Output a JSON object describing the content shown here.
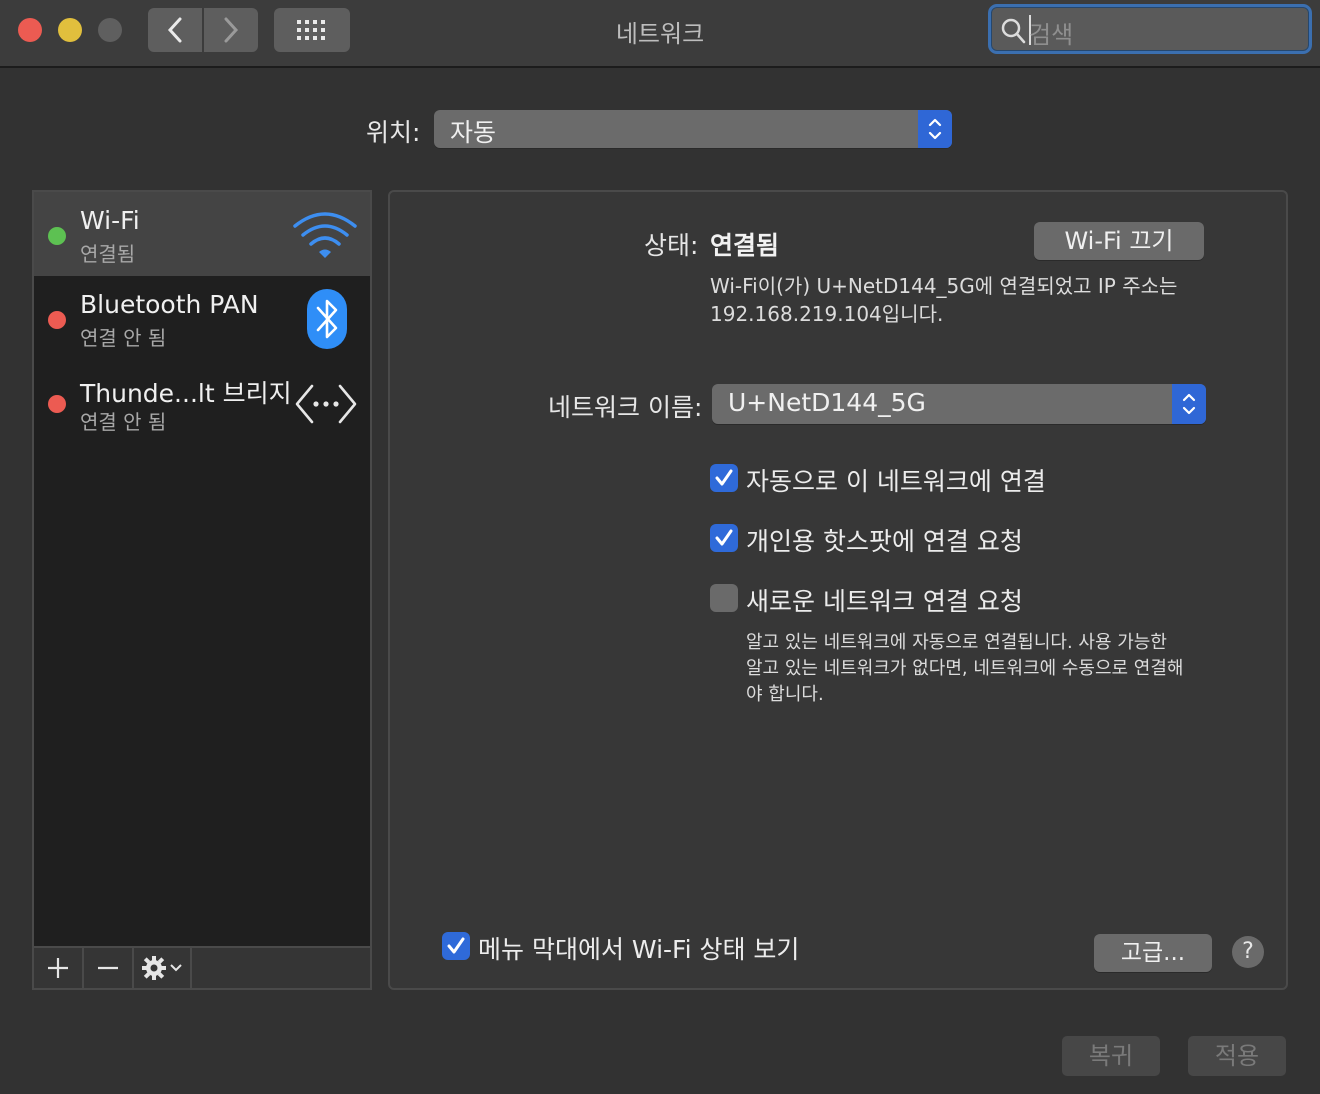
{
  "window": {
    "title": "네트워크"
  },
  "search": {
    "placeholder": "검색"
  },
  "location": {
    "label": "위치:",
    "value": "자동"
  },
  "services": [
    {
      "name": "Wi-Fi",
      "status": "연결됨",
      "indicator": "#5dc152",
      "icon": "wifi-icon"
    },
    {
      "name": "Bluetooth PAN",
      "status": "연결 안 됨",
      "indicator": "#ec5b52",
      "icon": "bluetooth-icon"
    },
    {
      "name": "Thunde...lt 브리지",
      "status": "연결 안 됨",
      "indicator": "#ec5b52",
      "icon": "thunderbolt-bridge-icon"
    }
  ],
  "detail": {
    "status_label": "상태:",
    "status_value": "연결됨",
    "wifi_off_button": "Wi-Fi 끄기",
    "status_desc_line1": "Wi-Fi이(가) U+NetD144_5G에 연결되었고 IP 주소는",
    "status_desc_line2": "192.168.219.104입니다.",
    "network_name_label": "네트워크 이름:",
    "network_name_value": "U+NetD144_5G",
    "options": [
      {
        "label": "자동으로 이 네트워크에 연결",
        "checked": true
      },
      {
        "label": "개인용 핫스팟에 연결 요청",
        "checked": true
      },
      {
        "label": "새로운 네트워크 연결 요청",
        "checked": false
      }
    ],
    "ask_desc_line1": "알고 있는 네트워크에 자동으로 연결됩니다. 사용 가능한",
    "ask_desc_line2": "알고 있는 네트워크가 없다면, 네트워크에 수동으로 연결해",
    "ask_desc_line3": "야 합니다.",
    "menu_bar_label": "메뉴 막대에서 Wi-Fi 상태 보기",
    "menu_bar_checked": true,
    "advanced_button": "고급...",
    "help": "?"
  },
  "footer": {
    "revert": "복귀",
    "apply": "적용"
  },
  "colors": {
    "accent": "#2f6ad9",
    "background": "#323232"
  }
}
